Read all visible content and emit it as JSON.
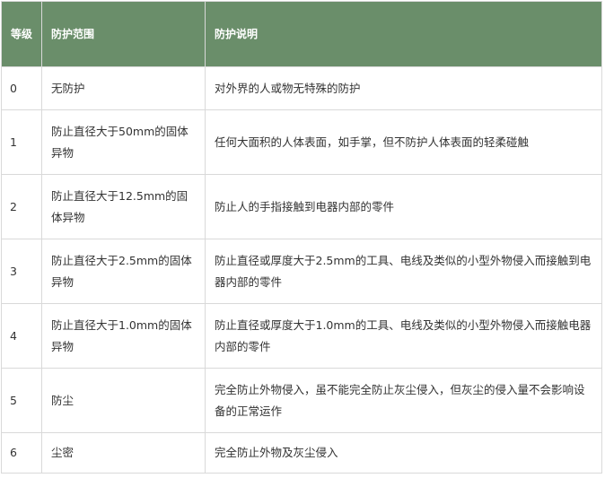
{
  "table": {
    "headers": {
      "grade": "等级",
      "scope": "防护范围",
      "description": "防护说明"
    },
    "rows": [
      {
        "grade": "0",
        "scope": "无防护",
        "description": "对外界的人或物无特殊的防护"
      },
      {
        "grade": "1",
        "scope": "防止直径大于50mm的固体异物",
        "description": "任何大面积的人体表面，如手掌，但不防护人体表面的轻柔碰触"
      },
      {
        "grade": "2",
        "scope": "防止直径大于12.5mm的固体异物",
        "description": "防止人的手指接触到电器内部的零件"
      },
      {
        "grade": "3",
        "scope": "防止直径大于2.5mm的固体异物",
        "description": "防止直径或厚度大于2.5mm的工具、电线及类似的小型外物侵入而接触到电器内部的零件"
      },
      {
        "grade": "4",
        "scope": "防止直径大于1.0mm的固体异物",
        "description": "防止直径或厚度大于1.0mm的工具、电线及类似的小型外物侵入而接触电器内部的零件"
      },
      {
        "grade": "5",
        "scope": "防尘",
        "description": "完全防止外物侵入，虽不能完全防止灰尘侵入，但灰尘的侵入量不会影响设备的正常运作"
      },
      {
        "grade": "6",
        "scope": "尘密",
        "description": "完全防止外物及灰尘侵入"
      }
    ]
  },
  "colors": {
    "header_bg": "#6a8e6a",
    "header_text": "#ffffff",
    "border": "#d9d9d9",
    "body_text": "#333333"
  }
}
